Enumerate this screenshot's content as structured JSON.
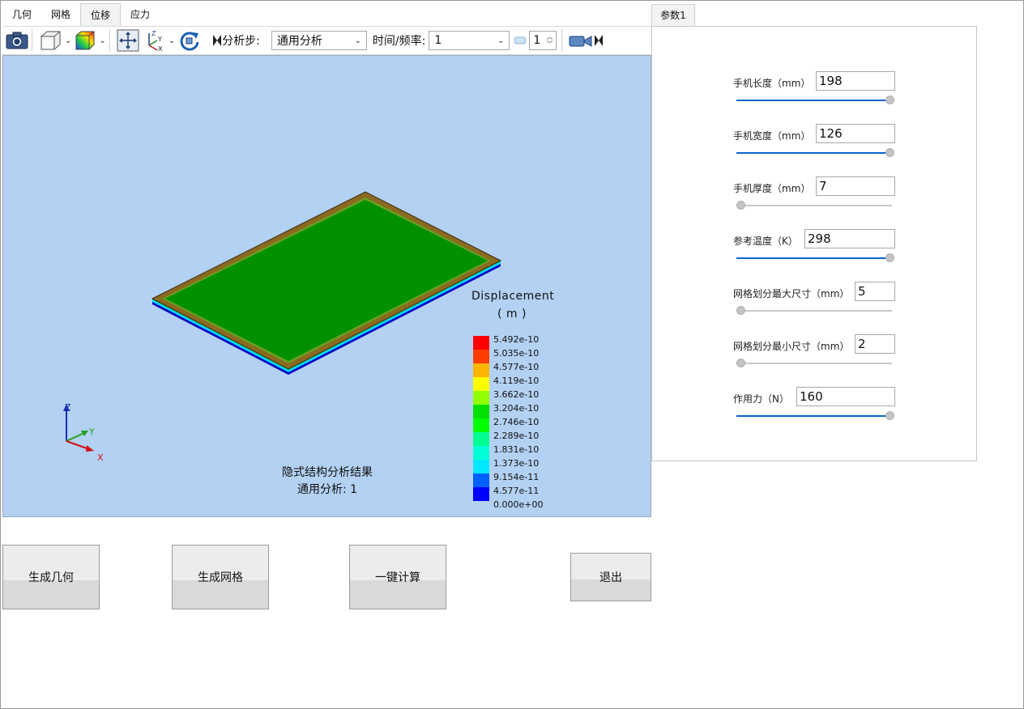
{
  "tabs": [
    "几何",
    "网格",
    "位移",
    "应力"
  ],
  "active_tab_index": 2,
  "toolbar": {
    "step_label": "分析步:",
    "step_value": "通用分析",
    "time_label": "时间/频率:",
    "time_value": "1",
    "frame_value": "1"
  },
  "viewport": {
    "background": "#b3d1f2",
    "legend": {
      "title": "Displacement",
      "unit": "( m )",
      "entries": [
        "5.492e-10",
        "5.035e-10",
        "4.577e-10",
        "4.119e-10",
        "3.662e-10",
        "3.204e-10",
        "2.746e-10",
        "2.289e-10",
        "1.831e-10",
        "1.373e-10",
        "9.154e-11",
        "4.577e-11",
        "0.000e+00"
      ],
      "colors": [
        "#ff0000",
        "#ff3d00",
        "#ffb400",
        "#ffff00",
        "#90ff00",
        "#00e000",
        "#00ff00",
        "#00ff90",
        "#00ffd8",
        "#00e8ff",
        "#0060ff",
        "#0000ff"
      ]
    },
    "axes": {
      "z": "Z",
      "y": "Y",
      "x": "X"
    },
    "caption_line1": "隐式结构分析结果",
    "caption_line2": "通用分析: 1"
  },
  "panel": {
    "tab_label": "参数1",
    "params": [
      {
        "label": "手机长度（mm）",
        "value": "198",
        "fraction": 1.0
      },
      {
        "label": "手机宽度（mm）",
        "value": "126",
        "fraction": 1.0
      },
      {
        "label": "手机厚度（mm）",
        "value": "7",
        "fraction": 0.0
      },
      {
        "label": "参考温度（K）",
        "value": "298",
        "fraction": 1.0
      },
      {
        "label": "网格划分最大尺寸（mm）",
        "value": "5",
        "fraction": 0.0
      },
      {
        "label": "网格划分最小尺寸（mm）",
        "value": "2",
        "fraction": 0.0
      },
      {
        "label": "作用力（N）",
        "value": "160",
        "fraction": 1.0
      }
    ]
  },
  "buttons": {
    "gen_geometry": "生成几何",
    "gen_mesh": "生成网格",
    "compute": "一键计算",
    "exit": "退出"
  }
}
